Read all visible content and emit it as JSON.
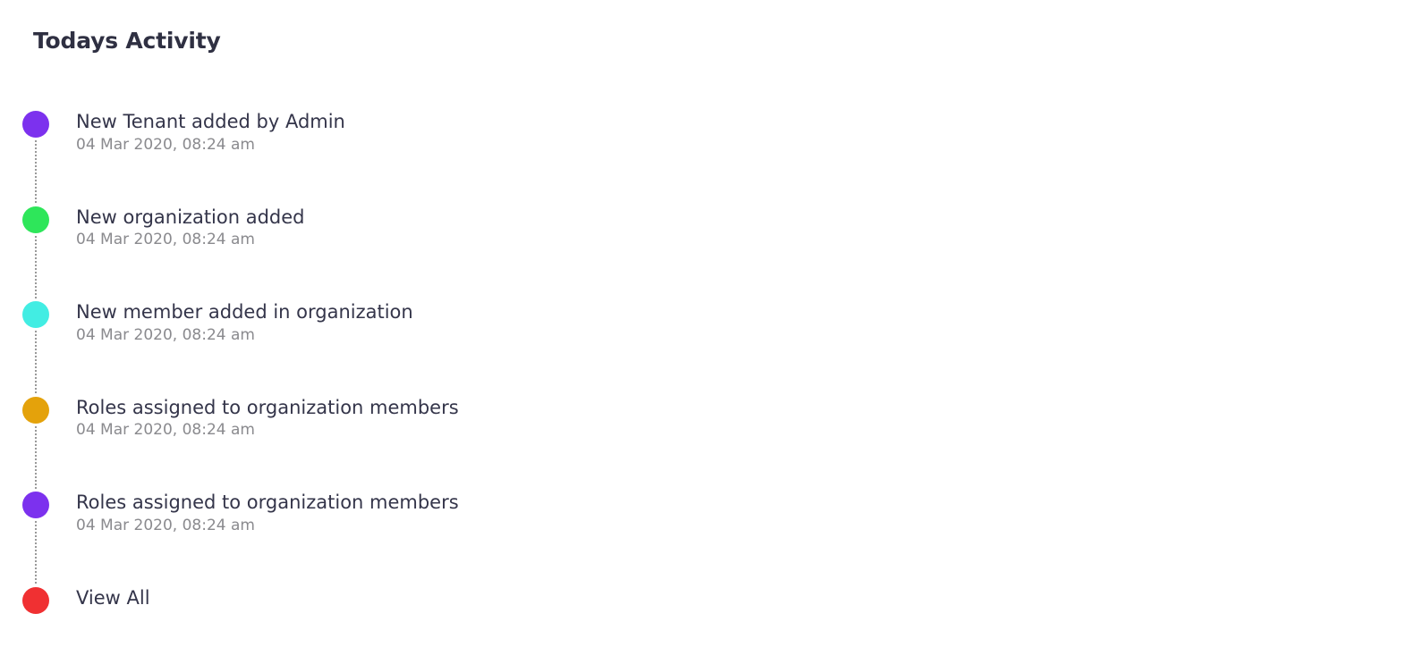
{
  "header": {
    "title": "Todays Activity"
  },
  "activities": [
    {
      "title": "New Tenant added by Admin",
      "time": "04 Mar 2020, 08:24 am",
      "color": "#7c31ee"
    },
    {
      "title": "New organization added",
      "time": "04 Mar 2020, 08:24 am",
      "color": "#2ee65a"
    },
    {
      "title": "New member added in organization",
      "time": "04 Mar 2020, 08:24 am",
      "color": "#42ede3"
    },
    {
      "title": "Roles assigned to organization members",
      "time": "04 Mar 2020, 08:24 am",
      "color": "#e4a20b"
    },
    {
      "title": "Roles assigned to organization members",
      "time": "04 Mar 2020, 08:24 am",
      "color": "#7c31ee"
    }
  ],
  "view_all": {
    "label": "View All",
    "color": "#f03032"
  },
  "icons": {
    "timeline_dot": "timeline-dot-icon"
  }
}
